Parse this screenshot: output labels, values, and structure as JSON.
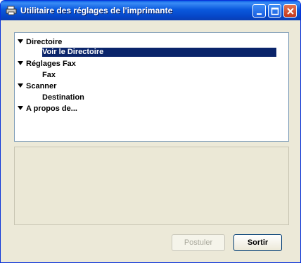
{
  "window": {
    "title": "Utilitaire des réglages de l'imprimante"
  },
  "tree": {
    "items": [
      {
        "label": "Directoire",
        "level": 0,
        "expanded": true
      },
      {
        "label": "Voir le Directoire",
        "level": 1,
        "selected": true
      },
      {
        "label": "Réglages Fax",
        "level": 0,
        "expanded": true
      },
      {
        "label": "Fax",
        "level": 1
      },
      {
        "label": "Scanner",
        "level": 0,
        "expanded": true
      },
      {
        "label": "Destination",
        "level": 1
      },
      {
        "label": "A propos de...",
        "level": 0,
        "expanded": true
      }
    ]
  },
  "buttons": {
    "postuler": "Postuler",
    "sortir": "Sortir"
  },
  "colors": {
    "titlebar": "#0a5fe6",
    "selection": "#0a246a",
    "close": "#c4381c"
  }
}
